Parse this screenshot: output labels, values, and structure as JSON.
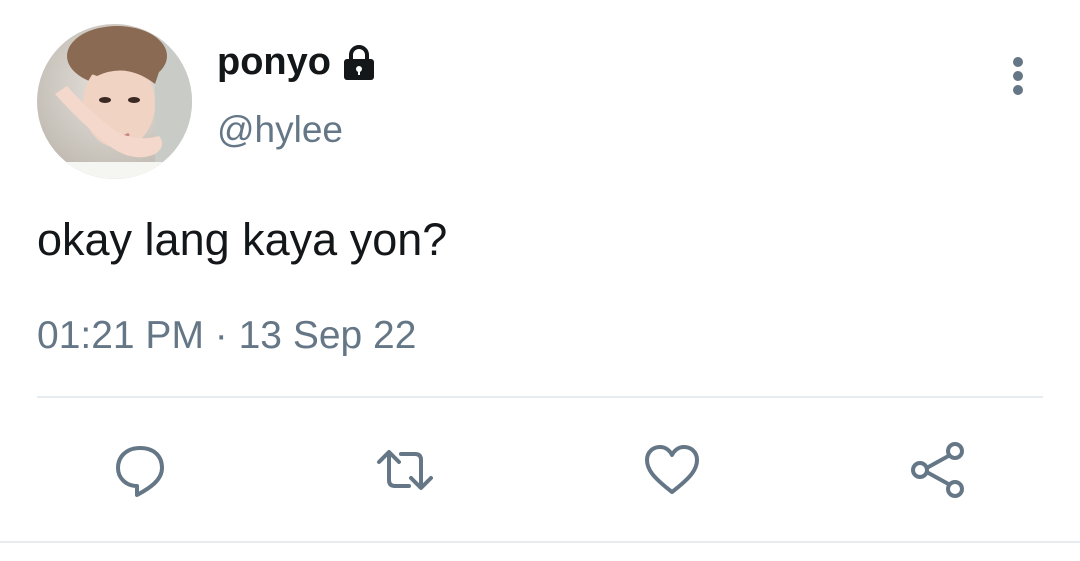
{
  "tweet": {
    "display_name": "ponyo",
    "handle": "@hylee",
    "text": "okay lang kaya yon?",
    "time": "01:21 PM",
    "separator": " · ",
    "date": "13 Sep 22",
    "protected": true
  },
  "icons": {
    "avatar": "avatar-photo",
    "lock": "lock-icon",
    "more": "vertical-ellipsis-icon",
    "reply": "reply-icon",
    "retweet": "retweet-icon",
    "like": "heart-icon",
    "share": "share-icon"
  },
  "colors": {
    "text_primary": "#14171a",
    "text_secondary": "#657786",
    "icon": "#657786",
    "divider": "#e6ecf0",
    "background": "#ffffff"
  }
}
